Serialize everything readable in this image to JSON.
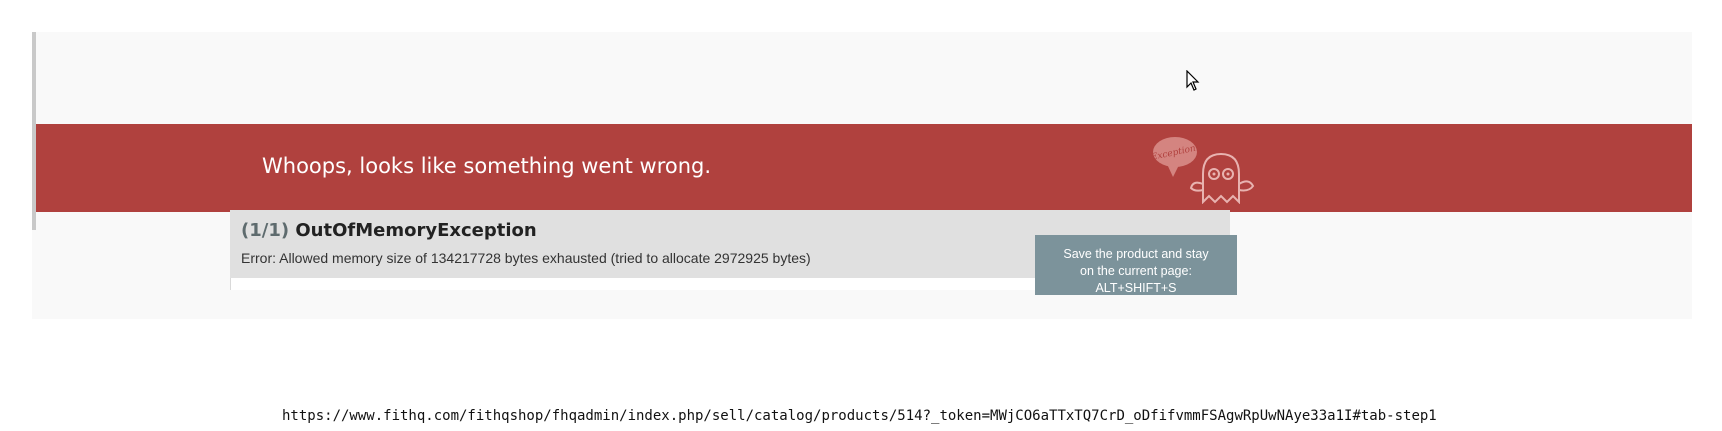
{
  "error_page": {
    "banner_title": "Whoops, looks like something went wrong.",
    "banner_color": "#b0413e",
    "mascot_icon": "exception-ghosts-icon",
    "mascot_bubble_text": "Exception!"
  },
  "exception": {
    "counter": "(1/1)",
    "class_name": "OutOfMemoryException",
    "message": "Error: Allowed memory size of 134217728 bytes exhausted (tried to allocate 2972925 bytes)"
  },
  "tooltip": {
    "line1": "Save the product and stay",
    "line2": "on the current page:",
    "line3": "ALT+SHIFT+S"
  },
  "status_url": "https://www.fithq.com/fithqshop/fhqadmin/index.php/sell/catalog/products/514?_token=MWjCO6aTTxTQ7CrD_oDfifvmmFSAgwRpUwNAye33a1I#tab-step1"
}
